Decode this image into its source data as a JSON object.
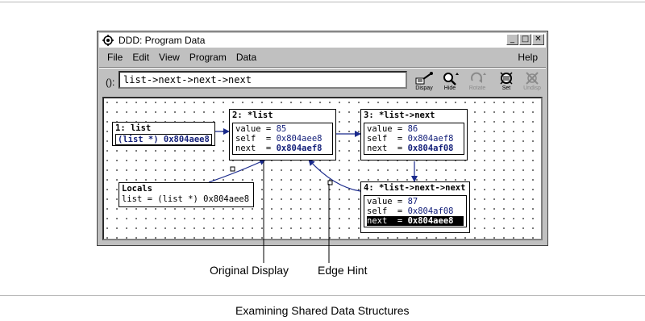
{
  "window": {
    "title": "DDD: Program Data",
    "menus": [
      "File",
      "Edit",
      "View",
      "Program",
      "Data"
    ],
    "help": "Help"
  },
  "toolbar": {
    "arg_label": "():",
    "arg_value": "list->next->next->next",
    "tools": [
      {
        "label": "Dispay",
        "icon": "display-icon",
        "enabled": true
      },
      {
        "label": "Hide",
        "icon": "hide-icon",
        "enabled": true
      },
      {
        "label": "Rotate",
        "icon": "rotate-icon",
        "enabled": false
      },
      {
        "label": "Set",
        "icon": "set-icon",
        "enabled": true
      },
      {
        "label": "Undisp",
        "icon": "undisp-icon",
        "enabled": false
      }
    ]
  },
  "displays": [
    {
      "title": "1: list",
      "rows": [
        {
          "text": "(list *) 0x804aee8"
        }
      ]
    },
    {
      "title": "2: *list",
      "rows": [
        {
          "key": "value",
          "value": "85"
        },
        {
          "key": "self ",
          "value": "0x804aee8"
        },
        {
          "key": "next ",
          "value": "0x804aef8"
        }
      ]
    },
    {
      "title": "3: *list->next",
      "rows": [
        {
          "key": "value",
          "value": "86"
        },
        {
          "key": "self ",
          "value": "0x804aef8"
        },
        {
          "key": "next ",
          "value": "0x804af08"
        }
      ]
    },
    {
      "title": "4: *list->next->next",
      "rows": [
        {
          "key": "value",
          "value": "87"
        },
        {
          "key": "self ",
          "value": "0x804af08"
        },
        {
          "key": "next ",
          "value": "0x804aee8"
        }
      ]
    },
    {
      "title": "Locals",
      "rows": [
        {
          "text": "list = (list *) 0x804aee8"
        }
      ]
    }
  ],
  "callouts": {
    "original_display": "Original Display",
    "edge_hint": "Edge Hint"
  },
  "figure_caption": "Examining Shared Data Structures",
  "colors": {
    "value_text": "#14207a",
    "edge": "#1a2a8c",
    "window_bg": "#c0c0c0"
  }
}
